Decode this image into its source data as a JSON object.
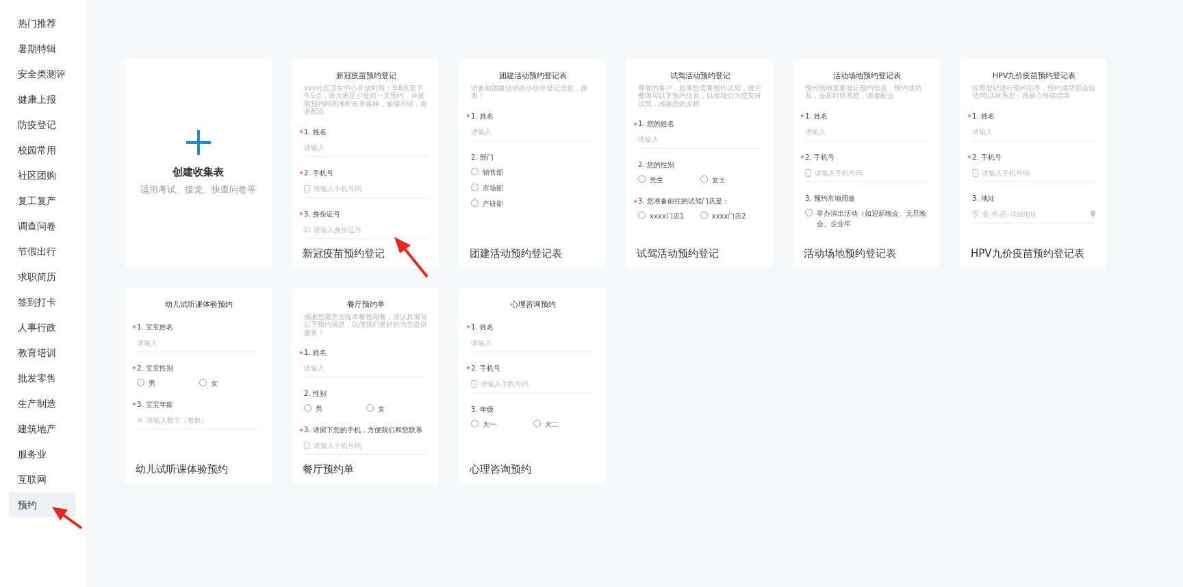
{
  "sidebar": {
    "items": [
      {
        "label": "热门推荐",
        "selected": false
      },
      {
        "label": "暑期特辑",
        "selected": false
      },
      {
        "label": "安全类测评",
        "selected": false
      },
      {
        "label": "健康上报",
        "selected": false
      },
      {
        "label": "防疫登记",
        "selected": false
      },
      {
        "label": "校园常用",
        "selected": false
      },
      {
        "label": "社区团购",
        "selected": false
      },
      {
        "label": "复工复产",
        "selected": false
      },
      {
        "label": "调查问卷",
        "selected": false
      },
      {
        "label": "节假出行",
        "selected": false
      },
      {
        "label": "求职简历",
        "selected": false
      },
      {
        "label": "签到打卡",
        "selected": false
      },
      {
        "label": "人事行政",
        "selected": false
      },
      {
        "label": "教育培训",
        "selected": false
      },
      {
        "label": "批发零售",
        "selected": false
      },
      {
        "label": "生产制造",
        "selected": false
      },
      {
        "label": "建筑地产",
        "selected": false
      },
      {
        "label": "服务业",
        "selected": false
      },
      {
        "label": "互联网",
        "selected": false
      },
      {
        "label": "预约",
        "selected": true
      }
    ]
  },
  "cards": [
    {
      "kind": "create",
      "title": "创建收集表",
      "subtitle": "适用考试、接龙、快查问卷等"
    },
    {
      "kind": "template",
      "form_title": "新冠疫苗预约登记",
      "description": "xxx社区卫生中心开放时间：早8点至下午5点，请大家至少提前一天预约，并按照预约时间准时前来接种，逾期不候，谢谢配合",
      "fields": [
        {
          "label": "1. 姓名",
          "required": true,
          "kind": "text",
          "placeholder": "请输入"
        },
        {
          "label": "2. 手机号",
          "required": true,
          "kind": "phone",
          "placeholder": "请输入手机号码"
        },
        {
          "label": "3. 身份证号",
          "required": true,
          "kind": "id",
          "placeholder": "请输入身份证号"
        }
      ],
      "name": "新冠疫苗预约登记"
    },
    {
      "kind": "template",
      "form_title": "团建活动预约登记表",
      "description": "请参加团建活动的小伙伴登记信息，谢谢！",
      "fields": [
        {
          "label": "1. 姓名",
          "required": true,
          "kind": "text",
          "placeholder": "请输入"
        },
        {
          "label": "2. 部门",
          "required": false,
          "kind": "radio-stacked",
          "options": [
            {
              "label": "销售部",
              "selected": false
            },
            {
              "label": "市场部",
              "selected": false
            },
            {
              "label": "产研部",
              "selected": false
            }
          ]
        }
      ],
      "name": "团建活动预约登记表"
    },
    {
      "kind": "template",
      "form_title": "试驾活动预约登记",
      "description": "尊敬的客户，如果您需要预约试驾，请完整填写以下预约信息，以便我们为您安排试驾，感谢您的支持",
      "fields": [
        {
          "label": "1. 您的姓名",
          "required": true,
          "kind": "text",
          "placeholder": "请输入"
        },
        {
          "label": "2. 您的性别",
          "required": false,
          "kind": "radio",
          "options": [
            {
              "label": "先生",
              "selected": false
            },
            {
              "label": "女士",
              "selected": false
            }
          ]
        },
        {
          "label": "3. 您准备前往的试驾门店是：",
          "required": true,
          "kind": "radio",
          "options": [
            {
              "label": "xxxx门店1",
              "selected": false
            },
            {
              "label": "xxxx门店2",
              "selected": false
            }
          ]
        }
      ],
      "name": "试驾活动预约登记"
    },
    {
      "kind": "template",
      "form_title": "活动场地预约登记表",
      "description": "预约场地需要登记预约信息，预约成功后，会及时联系您，谢谢配合",
      "fields": [
        {
          "label": "1. 姓名",
          "required": true,
          "kind": "text",
          "placeholder": "请输入"
        },
        {
          "label": "2. 手机号",
          "required": true,
          "kind": "phone",
          "placeholder": "请输入手机号码"
        },
        {
          "label": "3. 预约常地用途",
          "required": false,
          "kind": "radio-stacked",
          "options": [
            {
              "label": "举办演出活动（如迎新晚会、元旦晚会、企业年",
              "selected": false
            }
          ]
        }
      ],
      "name": "活动场地预约登记表"
    },
    {
      "kind": "template",
      "form_title": "HPV九价疫苗预约登记表",
      "description": "按照登记进行预约排序，预约成功后会短信/电话联系您，请耐心等待结果",
      "fields": [
        {
          "label": "1. 姓名",
          "required": true,
          "kind": "text",
          "placeholder": "请输入"
        },
        {
          "label": "2. 手机号",
          "required": true,
          "kind": "phone",
          "placeholder": "请输入手机号码"
        },
        {
          "label": "3. 地址",
          "required": false,
          "kind": "address",
          "placeholder": "省-市-区-详细地址"
        }
      ],
      "name": "HPV九价疫苗预约登记表"
    },
    {
      "kind": "template",
      "form_title": "幼儿试听课体验预约",
      "fields": [
        {
          "label": "1. 宝宝姓名",
          "required": true,
          "kind": "text",
          "placeholder": "请输入"
        },
        {
          "label": "2. 宝宝性别",
          "required": true,
          "kind": "radio",
          "options": [
            {
              "label": "男",
              "selected": false
            },
            {
              "label": "女",
              "selected": false
            }
          ]
        },
        {
          "label": "3. 宝宝年龄",
          "required": true,
          "kind": "number",
          "placeholder": "请输入数字（整数）"
        }
      ],
      "name": "幼儿试听课体验预约"
    },
    {
      "kind": "template",
      "form_title": "餐厅预约单",
      "description": "感谢您愿意光临本餐馆用餐，请认真填写以下预约信息，以便我们更好的为您提供服务！",
      "fields": [
        {
          "label": "1. 姓名",
          "required": true,
          "kind": "text",
          "placeholder": "请输入"
        },
        {
          "label": "2. 性别",
          "required": false,
          "kind": "radio",
          "options": [
            {
              "label": "男",
              "selected": false
            },
            {
              "label": "女",
              "selected": false
            }
          ]
        },
        {
          "label": "3. 请留下您的手机，方便我们和您联系",
          "required": true,
          "kind": "phone",
          "placeholder": "请输入手机号码"
        }
      ],
      "name": "餐厅预约单"
    },
    {
      "kind": "template",
      "form_title": "心理咨询预约",
      "fields": [
        {
          "label": "1. 姓名",
          "required": true,
          "kind": "text",
          "placeholder": "请输入"
        },
        {
          "label": "2. 手机号",
          "required": true,
          "kind": "phone",
          "placeholder": "请输入手机号码"
        },
        {
          "label": "3. 年级",
          "required": false,
          "kind": "radio",
          "options": [
            {
              "label": "大一",
              "selected": false
            },
            {
              "label": "大二",
              "selected": false
            }
          ]
        }
      ],
      "name": "心理咨询预约"
    }
  ]
}
